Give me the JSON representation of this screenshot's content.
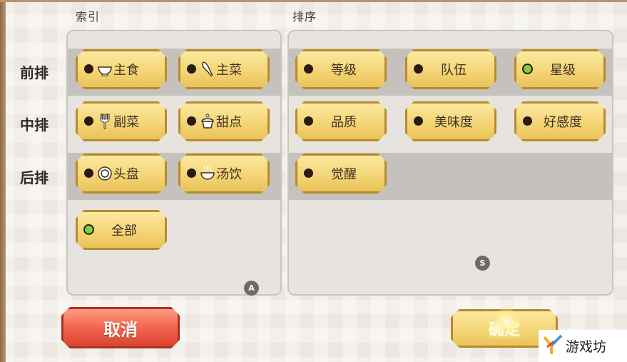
{
  "index_panel": {
    "title": "索引",
    "row_labels": [
      "前排",
      "中排",
      "后排"
    ],
    "filters": [
      {
        "label": "主食",
        "icon": "bowl-icon",
        "selected": false
      },
      {
        "label": "主菜",
        "icon": "drumstick-icon",
        "selected": false
      },
      {
        "label": "副菜",
        "icon": "fork-icon",
        "selected": false
      },
      {
        "label": "甜点",
        "icon": "cupcake-icon",
        "selected": false
      },
      {
        "label": "头盘",
        "icon": "plate-icon",
        "selected": false
      },
      {
        "label": "汤饮",
        "icon": "steaming-bowl-icon",
        "selected": false
      },
      {
        "label": "全部",
        "icon": "",
        "selected": true
      }
    ],
    "hint_key": "A"
  },
  "sort_panel": {
    "title": "排序",
    "options": [
      {
        "label": "等级",
        "selected": false
      },
      {
        "label": "队伍",
        "selected": false
      },
      {
        "label": "星级",
        "selected": true
      },
      {
        "label": "品质",
        "selected": false
      },
      {
        "label": "美味度",
        "selected": false
      },
      {
        "label": "好感度",
        "selected": false
      },
      {
        "label": "觉醒",
        "selected": false
      }
    ],
    "hint_key": "S"
  },
  "buttons": {
    "cancel": "取消",
    "confirm": "确定"
  },
  "watermark": {
    "text": "游戏坊"
  },
  "colors": {
    "selected_dot": "#7cd23a",
    "unselected_dot": "#2b1a12",
    "tag_gold": "#f4d373",
    "cancel_red": "#f0614a"
  }
}
